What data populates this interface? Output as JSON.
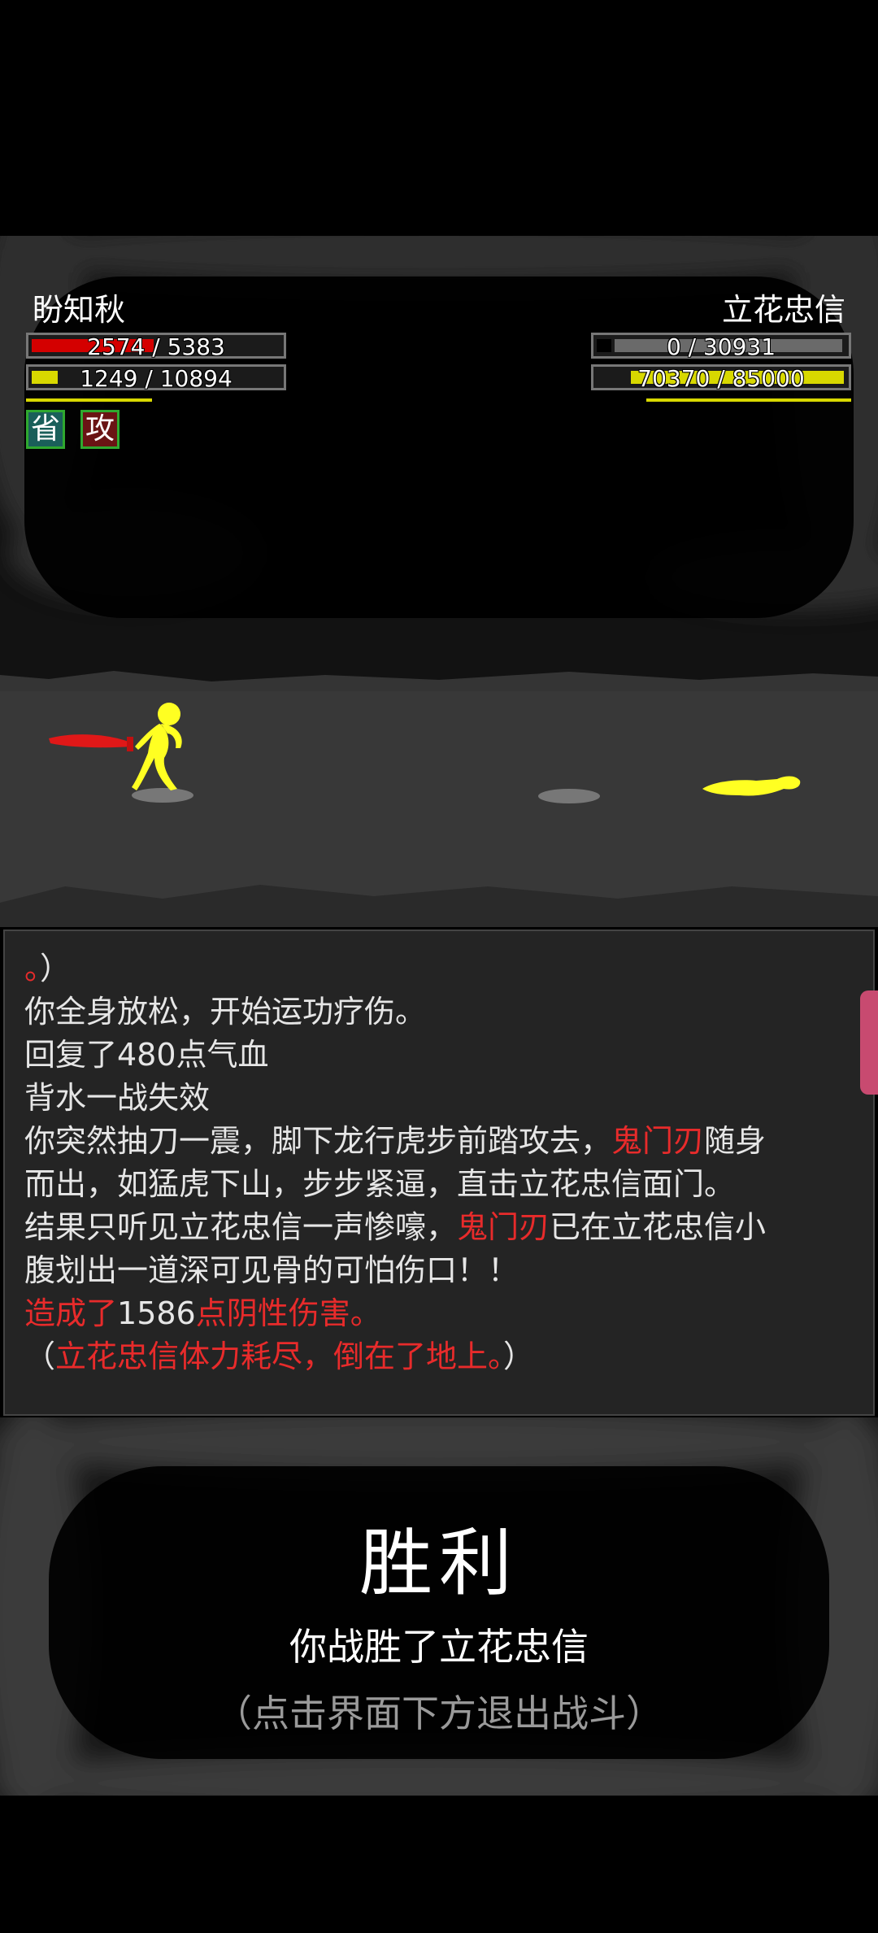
{
  "player": {
    "name": "盼知秋",
    "hp_text": "2574 / 5383",
    "hp": 2574,
    "hp_max": 5383,
    "mp_text": "1249 / 10894",
    "mp": 1249,
    "mp_max": 10894,
    "status_badges": [
      "省",
      "攻"
    ]
  },
  "enemy": {
    "name": "立花忠信",
    "hp_text": "0 / 30931",
    "hp": 0,
    "hp_max": 30931,
    "mp_text": "70370 / 85000",
    "mp": 70370,
    "mp_max": 85000
  },
  "colors": {
    "hp_fill": "#d40000",
    "mp_fill": "#d8d800",
    "log_red": "#e82b2b",
    "character": "#ffff22",
    "blade": "#e01818"
  },
  "log": {
    "cut_line_prefix": "。",
    "cut_line_suffix": "）",
    "lines": [
      "你全身放松，开始运功疗伤。",
      "回复了480点气血",
      "背水一战失效"
    ],
    "attack_1_a": "你突然抽刀一震，脚下龙行虎步前踏攻去，",
    "attack_1_weapon": "鬼门刃",
    "attack_1_b": "随身",
    "attack_1_c": "而出，如猛虎下山，步步紧逼，直击立花忠信面门。",
    "attack_2_a": "结果只听见立花忠信一声惨嚎，",
    "attack_2_weapon": "鬼门刃",
    "attack_2_b": "已在立花忠信小",
    "attack_2_c": "腹划出一道深可见骨的可怕伤口！！",
    "damage_a": "造成了",
    "damage_value": "1586",
    "damage_b": "点阴性伤害。",
    "fall_open": "（",
    "fall_text": "立花忠信体力耗尽，倒在了地上。",
    "fall_close": "）"
  },
  "result": {
    "title": "胜利",
    "subtitle": "你战胜了立花忠信",
    "hint": "（点击界面下方退出战斗）"
  }
}
